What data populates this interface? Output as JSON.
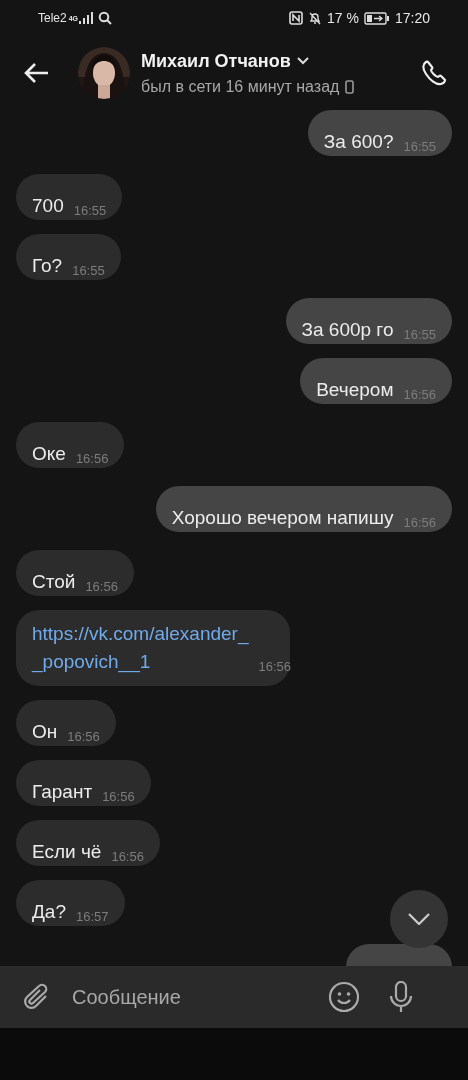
{
  "status_bar": {
    "carrier": "Tele2",
    "network": "4G",
    "battery_percent": "17 %",
    "time": "17:20"
  },
  "header": {
    "name": "Михаил Отчанов",
    "status": "был в сети 16 минут назад"
  },
  "messages": [
    {
      "outgoing": true,
      "kind": "text",
      "text": "За 600?",
      "time": "16:55"
    },
    {
      "outgoing": false,
      "kind": "text",
      "text": "700",
      "time": "16:55"
    },
    {
      "outgoing": false,
      "kind": "text",
      "text": "Го?",
      "time": "16:55"
    },
    {
      "outgoing": true,
      "kind": "text",
      "text": "За 600р го",
      "time": "16:55"
    },
    {
      "outgoing": true,
      "kind": "text",
      "text": "Вечером",
      "time": "16:56"
    },
    {
      "outgoing": false,
      "kind": "text",
      "text": "Оке",
      "time": "16:56"
    },
    {
      "outgoing": true,
      "kind": "text",
      "text": "Хорошо вечером напишу",
      "time": "16:56"
    },
    {
      "outgoing": false,
      "kind": "text",
      "text": "Стой",
      "time": "16:56"
    },
    {
      "outgoing": false,
      "kind": "link",
      "text": "https://vk.com/alexander_\n_popovich__1",
      "time": "16:56"
    },
    {
      "outgoing": false,
      "kind": "text",
      "text": "Он",
      "time": "16:56"
    },
    {
      "outgoing": false,
      "kind": "text",
      "text": "Гарант",
      "time": "16:56"
    },
    {
      "outgoing": false,
      "kind": "text",
      "text": "Если чё",
      "time": "16:56"
    },
    {
      "outgoing": false,
      "kind": "text",
      "text": "Да?",
      "time": "16:57"
    },
    {
      "outgoing": true,
      "kind": "partial"
    }
  ],
  "composer": {
    "placeholder": "Сообщение"
  }
}
